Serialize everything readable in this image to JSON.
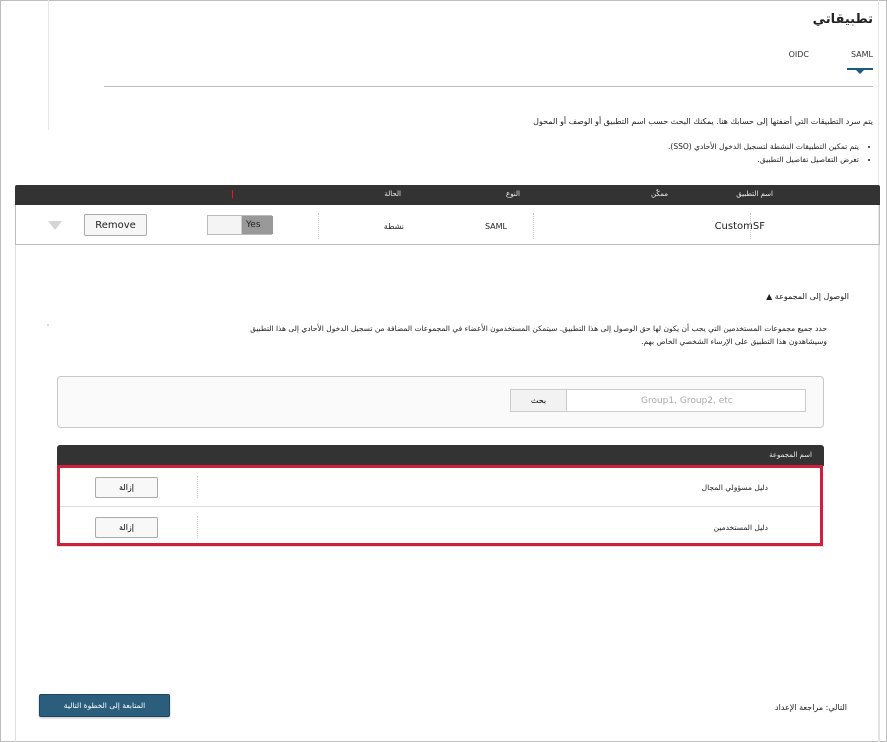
{
  "page": {
    "title": "تطبيقاتي",
    "tabs": [
      {
        "label": "SAML",
        "active": true
      },
      {
        "label": "OIDC",
        "active": false
      }
    ],
    "intro": "يتم سرد التطبيقات التي أضفتها إلى حسابك هنا. يمكنك البحث حسب اسم التطبيق أو الوصف أو المحول",
    "bullets": [
      "يتم تمكين التطبيقات النشطة لتسجيل الدخول الأحادي (SSO).",
      "تعرض التفاصيل تفاصيل التطبيق."
    ]
  },
  "apps_table": {
    "headers": {
      "name": "اسم التطبيق",
      "type": "النوع",
      "status": "الحالة",
      "enabled": "ممكّن"
    },
    "rows": [
      {
        "name": "CustomSF",
        "type": "SAML",
        "status": "نشطة",
        "toggle_label": "Yes",
        "remove_label": "Remove"
      }
    ]
  },
  "access": {
    "title": "الوصول إلى المجموعة",
    "description_line1": "حدد جميع مجموعات المستخدمين التي يجب أن يكون لها حق الوصول إلى هذا التطبيق. سيتمكن المستخدمون الأعضاء في المجموعات المضافة من تسجيل الدخول الأحادي إلى هذا التطبيق",
    "description_line2": "وسيشاهدون هذا التطبيق على الإرساء الشخصي الخاص بهم.",
    "search_placeholder": "Group1, Group2, etc",
    "search_button": "بحث"
  },
  "groups_table": {
    "header": "اسم المجموعة",
    "rows": [
      {
        "name": "دليل مسؤولي المجال",
        "remove_label": "إزالة"
      },
      {
        "name": "دليل المستخدمين",
        "remove_label": "إزالة"
      }
    ],
    "highlight_color": "#d01f3c"
  },
  "footer": {
    "next_label": "التالي: مراجعة الإعداد",
    "next_button": "المتابعة إلى الخطوة التالية"
  }
}
